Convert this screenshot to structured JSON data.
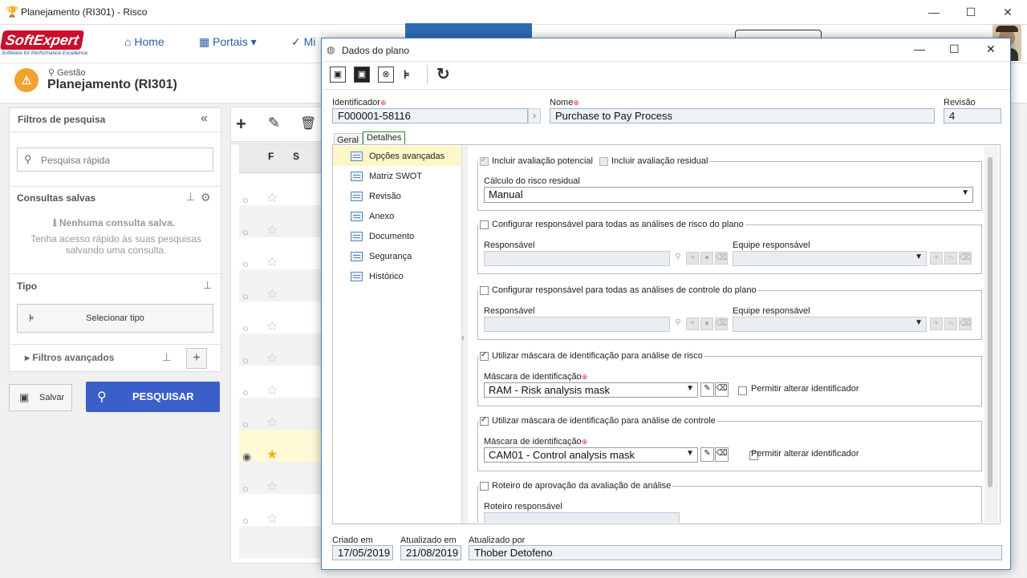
{
  "window": {
    "title": "Planejamento (RI301) - Risco",
    "minimize": "—",
    "maximize": "☐",
    "close": "✕"
  },
  "nav": {
    "home": "Home",
    "portals": "Portais",
    "more": "Mi"
  },
  "logo": {
    "brand_soft": "Soft",
    "brand_expert": "Expert",
    "tagline": "Software for Performance Excellence"
  },
  "breadcrumb": {
    "parent": "Gestão",
    "title": "Planejamento (RI301)"
  },
  "left": {
    "filters_title": "Filtros de pesquisa",
    "search_placeholder": "Pesquisa rápida",
    "saved_title": "Consultas salvas",
    "saved_empty": "Nenhuma consulta salva.",
    "saved_hint": "Tenha acesso rápido às suas pesquisas salvando uma consulta.",
    "type_title": "Tipo",
    "select_type": "Selecionar tipo",
    "advanced": "Filtros avançados",
    "save": "Salvar",
    "search": "PESQUISAR"
  },
  "grid": {
    "col_f": "F",
    "col_s": "S"
  },
  "dialog": {
    "title": "Dados do plano",
    "id_label": "Identificador",
    "id_value": "F000001-58116",
    "name_label": "Nome",
    "name_value": "Purchase to Pay Process",
    "rev_label": "Revisão",
    "rev_value": "4",
    "tabs": [
      "Geral",
      "Detalhes"
    ],
    "sidenav": [
      "Opções avançadas",
      "Matriz SWOT",
      "Revisão",
      "Anexo",
      "Documento",
      "Segurança",
      "Histórico"
    ],
    "g1_potential": "Incluir avaliação potencial",
    "g1_residual": "Incluir avaliação residual",
    "g1_calc_label": "Cálculo do risco residual",
    "g1_calc_value": "Manual",
    "g2_title": "Configurar responsável para todas as análises de risco do plano",
    "g3_title": "Configurar responsável para todas as análises de controle do plano",
    "resp_label": "Responsável",
    "team_label": "Equipe responsável",
    "g4_title": "Utilizar máscara de identificação para análise de risco",
    "mask_label": "Máscara de identificação",
    "g4_mask": "RAM - Risk analysis mask",
    "allow_change": "Permitir alterar identificador",
    "g5_title": "Utilizar máscara de identificação para análise de controle",
    "g5_mask": "CAM01 - Control analysis mask",
    "g6_title": "Roteiro de aprovação da avaliação de análise",
    "g6_label": "Roteiro responsável",
    "created_label": "Criado em",
    "created_value": "17/05/2019",
    "updated_label": "Atualizado em",
    "updated_value": "21/08/2019",
    "updated_by_label": "Atualizado por",
    "updated_by_value": "Thober Detofeno"
  },
  "colors": {
    "accent": "#2f6bb5",
    "search_btn": "#3b5fc9",
    "selected_row": "#fff9d6",
    "required": "#dd3333"
  }
}
